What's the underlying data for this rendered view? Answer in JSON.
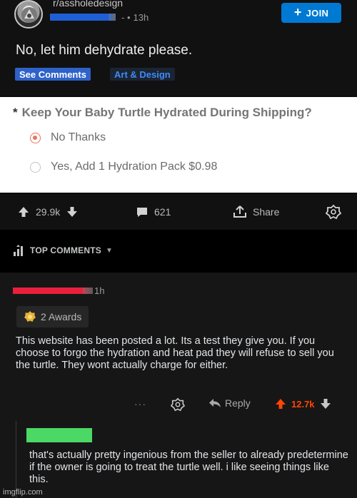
{
  "post": {
    "subreddit": "r/assholedesign",
    "time_ago": "13h",
    "join_label": "JOIN",
    "title": "No, let him dehydrate please.",
    "flairs": [
      "See Comments",
      "Art & Design"
    ]
  },
  "embed": {
    "question": "Keep Your Baby Turtle Hydrated During Shipping?",
    "asterisk": "*",
    "options": [
      {
        "label": "No Thanks",
        "selected": true
      },
      {
        "label": "Yes, Add 1 Hydration Pack $0.98",
        "selected": false
      }
    ]
  },
  "actions": {
    "votes": "29.9k",
    "comments": "621",
    "share": "Share"
  },
  "sort": {
    "label": "TOP COMMENTS"
  },
  "comment": {
    "time_ago": "1h",
    "awards": "2 Awards",
    "body": "This website has been posted a lot. Its a test they give you. If you choose to forgo the hydration and heat pad they will refuse to sell you the turtle. They wont actually charge for either.",
    "dots": "···",
    "reply_label": "Reply",
    "score": "12.7k"
  },
  "reply": {
    "body": "that's actually pretty ingenious from the seller to already predetermine if the owner is going to treat the turtle well. i like seeing things like this."
  },
  "watermark": "imgflip.com",
  "colors": {
    "join": "#0079d3",
    "upvote": "#ff4500",
    "flair_see": "#2e62c8",
    "redact_blue": "#1f5fd6",
    "redact_red": "#e8203b",
    "redact_green": "#4bd865",
    "radio_selected": "#e8735d"
  }
}
